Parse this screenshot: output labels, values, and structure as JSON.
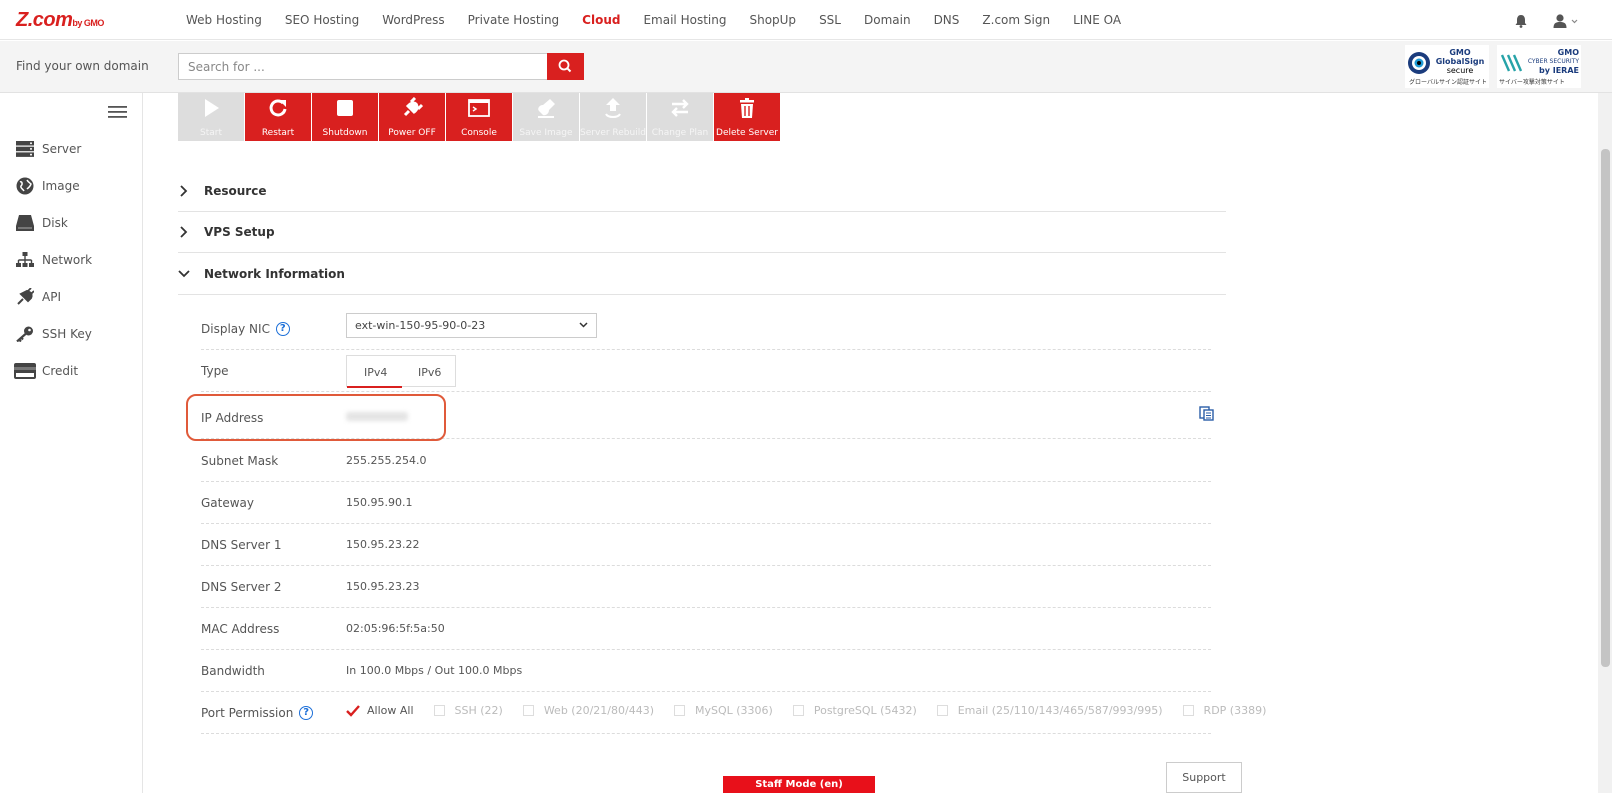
{
  "brand": {
    "logo_text": "Z.com",
    "logo_sub": "by GMO"
  },
  "nav": {
    "items": [
      {
        "label": "Web Hosting"
      },
      {
        "label": "SEO Hosting"
      },
      {
        "label": "WordPress"
      },
      {
        "label": "Private Hosting"
      },
      {
        "label": "Cloud",
        "active": true
      },
      {
        "label": "Email Hosting"
      },
      {
        "label": "ShopUp"
      },
      {
        "label": "SSL"
      },
      {
        "label": "Domain"
      },
      {
        "label": "DNS"
      },
      {
        "label": "Z.com Sign"
      },
      {
        "label": "LINE OA"
      }
    ]
  },
  "search": {
    "label": "Find your own domain",
    "placeholder": "Search for ..."
  },
  "badges": {
    "globalsign": {
      "l1": "GMO",
      "l2": "GlobalSign",
      "l3": "secure",
      "l4": "グローバルサイン認証サイト"
    },
    "ierae": {
      "l1": "GMO",
      "l2": "CYBER SECURITY",
      "l3": "by IERAE",
      "l4": "サイバー攻撃対策サイト"
    }
  },
  "sidebar": {
    "items": [
      {
        "label": "Server",
        "icon": "server-icon"
      },
      {
        "label": "Image",
        "icon": "globe-icon"
      },
      {
        "label": "Disk",
        "icon": "disk-icon"
      },
      {
        "label": "Network",
        "icon": "network-icon"
      },
      {
        "label": "API",
        "icon": "api-icon"
      },
      {
        "label": "SSH Key",
        "icon": "key-icon"
      },
      {
        "label": "Credit",
        "icon": "credit-card-icon"
      }
    ]
  },
  "toolbar": {
    "start": "Start",
    "restart": "Restart",
    "shutdown": "Shutdown",
    "power_off": "Power OFF",
    "console": "Console",
    "save_image": "Save Image",
    "server_rebuild": "Server Rebuild",
    "change_plan": "Change Plan",
    "delete_server": "Delete Server"
  },
  "sections": {
    "resource": "Resource",
    "vps_setup": "VPS Setup",
    "network_info": "Network Information"
  },
  "network": {
    "display_nic_label": "Display NIC",
    "display_nic_value": "ext-win-150-95-90-0-23",
    "type_label": "Type",
    "type_tabs": [
      "IPv4",
      "IPv6"
    ],
    "ip_label": "IP Address",
    "subnet_label": "Subnet Mask",
    "subnet_value": "255.255.254.0",
    "gateway_label": "Gateway",
    "gateway_value": "150.95.90.1",
    "dns1_label": "DNS Server 1",
    "dns1_value": "150.95.23.22",
    "dns2_label": "DNS Server 2",
    "dns2_value": "150.95.23.23",
    "mac_label": "MAC Address",
    "mac_value": "02:05:96:5f:5a:50",
    "bandwidth_label": "Bandwidth",
    "bandwidth_value": "In 100.0 Mbps / Out 100.0 Mbps",
    "port_label": "Port Permission",
    "ports": {
      "allow_all": "Allow All",
      "ssh": "SSH (22)",
      "web": "Web (20/21/80/443)",
      "mysql": "MySQL (3306)",
      "postgres": "PostgreSQL (5432)",
      "email": "Email (25/110/143/465/587/993/995)",
      "rdp": "RDP (3389)"
    }
  },
  "footer": {
    "support": "Support",
    "staff_mode": "Staff Mode (en)"
  },
  "colors": {
    "accent": "#d9201f",
    "disabled": "#dddddd",
    "help": "#1c6fd8"
  }
}
